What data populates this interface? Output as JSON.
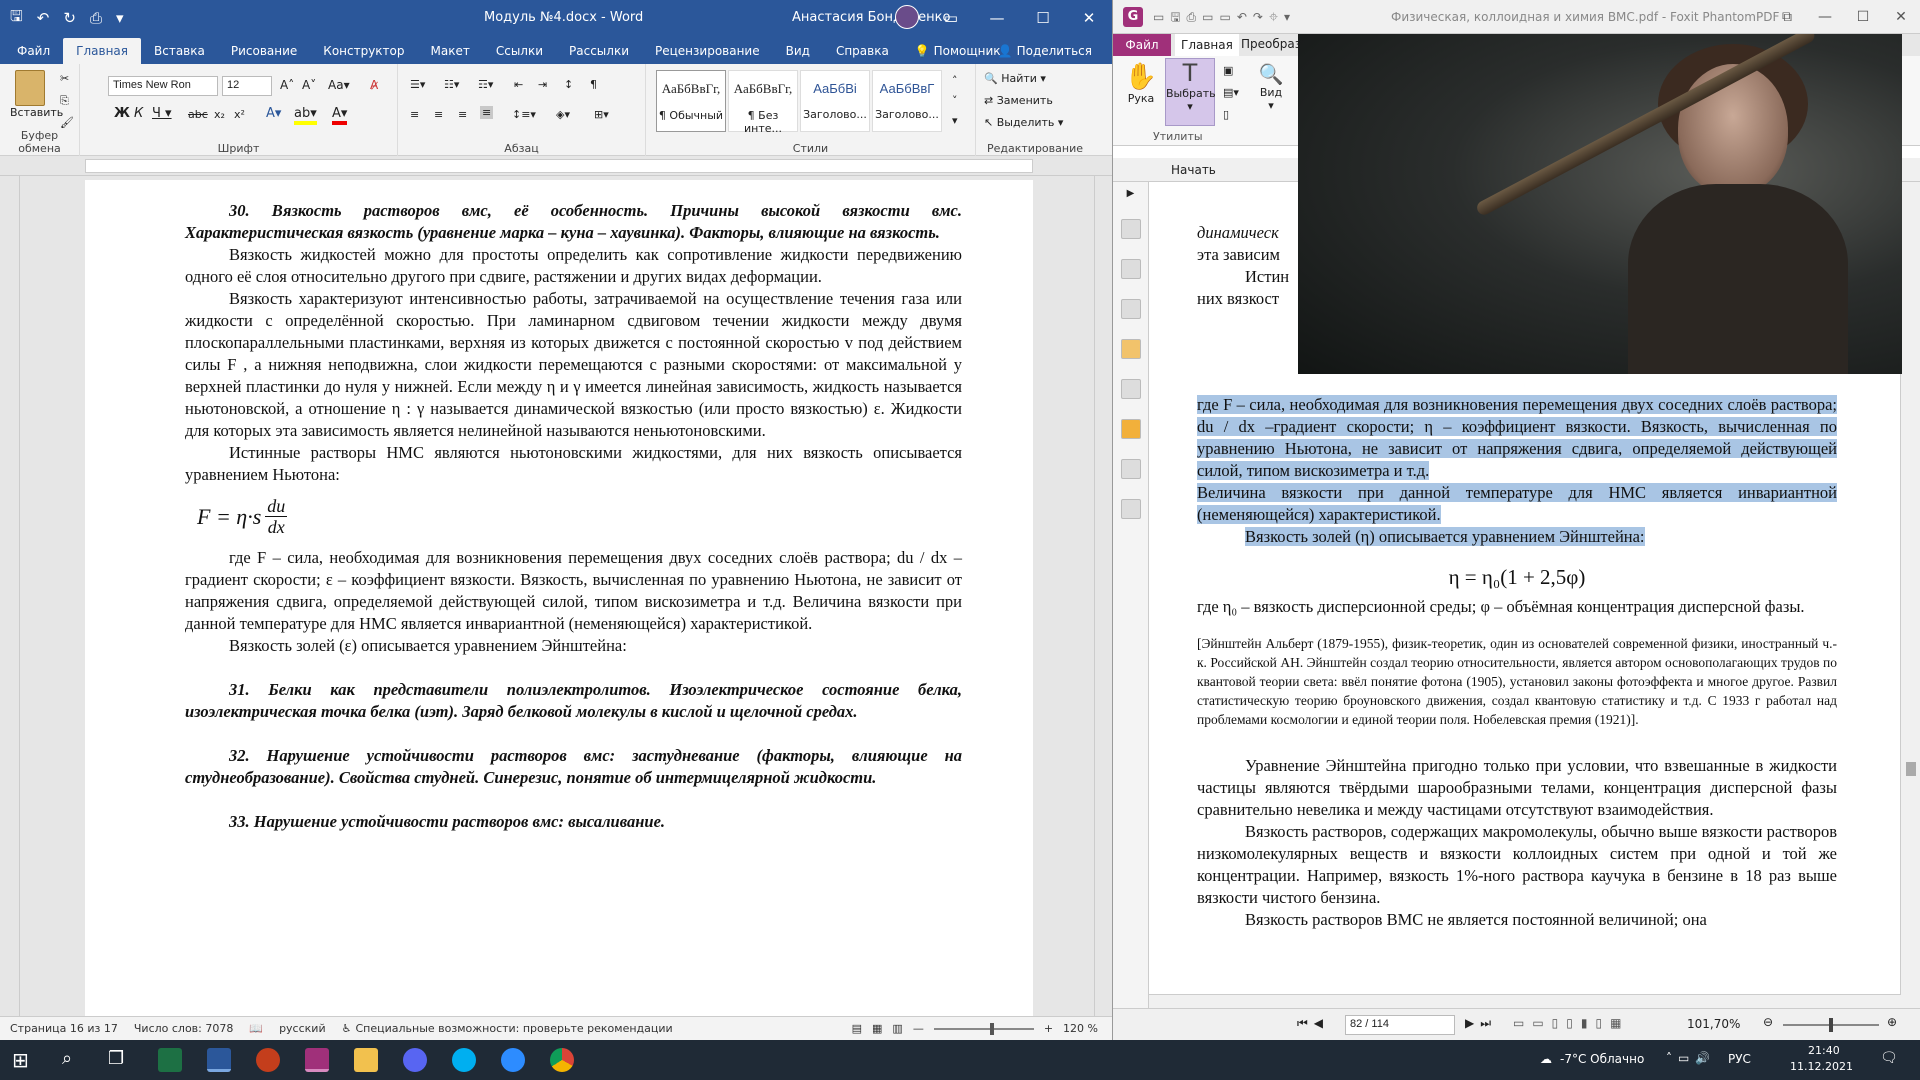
{
  "word": {
    "title": "Модуль №4.docx  -  Word",
    "user": "Анастасия Бондаренко",
    "tabs": [
      "Файл",
      "Главная",
      "Вставка",
      "Рисование",
      "Конструктор",
      "Макет",
      "Ссылки",
      "Рассылки",
      "Рецензирование",
      "Вид",
      "Справка",
      "Помощник"
    ],
    "share": "Поделиться",
    "ribbon": {
      "paste": "Вставить",
      "clipboard": "Буфер обмена",
      "font_group": "Шрифт",
      "paragraph_group": "Абзац",
      "styles_group": "Стили",
      "editing_group": "Редактирование",
      "font_name": "Times New Ron",
      "font_size": "12",
      "styles": [
        {
          "sample": "АаБбВвГг,",
          "name": "¶ Обычный"
        },
        {
          "sample": "АаБбВвГг,",
          "name": "¶ Без инте..."
        },
        {
          "sample": "АаБбВі",
          "name": "Заголово..."
        },
        {
          "sample": "АаБбВвГ",
          "name": "Заголово..."
        }
      ],
      "find": "Найти",
      "replace": "Заменить",
      "select": "Выделить"
    },
    "doc": {
      "h30": "30. Вязкость растворов вмс, её особенность. Причины высокой вязкости вмс. Характеристическая вязкость (уравнение марка – куна – хаувинка). Факторы, влияющие на вязкость.",
      "p1": "Вязкость жидкостей можно для простоты определить как сопротивление жидкости передвижению одного её слоя относительно другого при сдвиге, растяжении и других видах деформации.",
      "p2": "Вязкость характеризуют интенсивностью работы, затрачиваемой на осуществление течения газа или жидкости с определённой скоростью. При ламинарном сдвиговом течении жидкости между двумя плоскопараллельными пластинками, верхняя из которых движется с постоянной скоростью v под действием силы F , а нижняя неподвижна, слои жидкости перемещаются с разными скоростями: от максимальной у верхней пластинки до нуля у нижней. Если между η и γ имеется линейная зависимость, жидкость называется ньютоновской, а отношение η : γ называется  динамической вязкостью (или просто вязкостью) ε. Жидкости для которых эта зависимость является нелинейной называются неньютоновскими.",
      "p3": "Истинные растворы НМС являются ньютоновскими жидкостями, для них вязкость описывается уравнением Ньютона:",
      "formula_left": "F = η·s",
      "formula_num": "du",
      "formula_den": "dx",
      "p4": "где F – сила, необходимая для возникновения перемещения двух соседних слоёв раствора; du / dx –градиент скорости; ε – коэффициент вязкости. Вязкость, вычисленная по уравнению Ньютона, не зависит от напряжения сдвига, определяемой действующей силой, типом вискозиметра и т.д. Величина вязкости при данной температуре для НМС является инвариантной (неменяющейся) характеристикой.",
      "p5": "Вязкость золей (ε) описывается уравнением Эйнштейна:",
      "h31": "31. Белки как представители полиэлектролитов. Изоэлектрическое состояние белка, изоэлектрическая точка белка (иэт). Заряд белковой молекулы в кислой и щелочной средах.",
      "h32": "32. Нарушение устойчивости растворов вмс: застудневание (факторы, влияющие на студнеобразование). Свойства студней. Синерезис, понятие об интермицелярной жидкости.",
      "h33": "33. Нарушение устойчивости растворов вмс: высаливание."
    },
    "status": {
      "page": "Страница 16 из 17",
      "words": "Число слов: 7078",
      "lang": "русский",
      "access": "Специальные возможности: проверьте рекомендации",
      "zoom": "120 %"
    }
  },
  "foxit": {
    "title": "Физическая, коллоидная и химия ВМС.pdf - Foxit PhantomPDF",
    "tabs": {
      "file": "Файл",
      "home": "Главная",
      "convert": "Преобраз"
    },
    "ribbon": {
      "hand": "Рука",
      "select": "Выбрать",
      "view": "Вид",
      "utilities": "Утилиты"
    },
    "nav": "Начать",
    "doc": {
      "frag1": "динамическ",
      "frag2": "эта зависим",
      "frag3": "Истин",
      "frag4": "них вязкост",
      "p1": "где F – сила, необходимая для возникновения перемещения двух соседних слоёв раствора; du / dx –градиент скорости; η – коэффициент вязкости. Вязкость, вычисленная по уравнению Ньютона, не зависит от напряжения сдвига, определяемой действующей силой, типом вискозиметра и т.д.",
      "p2": "Величина вязкости при данной температуре для НМС является инвариантной (неменяющейся) характеристикой.",
      "p3": "Вязкость золей (η) описывается уравнением Эйнштейна:",
      "formula": "η = η₀(1 + 2,5φ)",
      "p4": "где η₀ – вязкость дисперсионной среды; φ – объёмная концентрация дисперсной фазы.",
      "note": "[Эйнштейн Альберт (1879-1955), физик-теоретик, один из основателей современной физики, иностранный ч.-к. Российской АН. Эйнштейн создал теорию относительности, является автором основополагающих трудов по квантовой теории света: ввёл понятие фотона (1905), установил законы фотоэффекта и многое другое. Развил статистическую теорию броуновского движения, создал квантовую статистику и т.д. С 1933 г работал над проблемами космологии и единой теории поля. Нобелевская премия (1921)].",
      "p5": "Уравнение Эйнштейна пригодно только при условии, что взвешанные в жидкости частицы являются твёрдыми шарообразными телами, концентрация дисперсной фазы сравнительно невелика и между частицами отсутствуют взаимодействия.",
      "p6": "Вязкость растворов, содержащих макромолекулы, обычно выше вязкости растворов низкомолекулярных веществ и вязкости коллоидных систем при одной и той же концентрации. Например, вязкость 1%-ного раствора каучука в бензине в 18 раз выше вязкости чистого бензина.",
      "p7": "Вязкость растворов ВМС не является постоянной величиной; она"
    },
    "status": {
      "page": "82 / 114",
      "zoom": "101,70%"
    }
  },
  "taskbar": {
    "weather": "-7°C  Облачно",
    "lang": "РУС",
    "time": "21:40",
    "date": "11.12.2021"
  },
  "colors": {
    "word_blue": "#2b579a",
    "foxit_purple": "#a0307a",
    "highlight": "#a9c5e4"
  }
}
